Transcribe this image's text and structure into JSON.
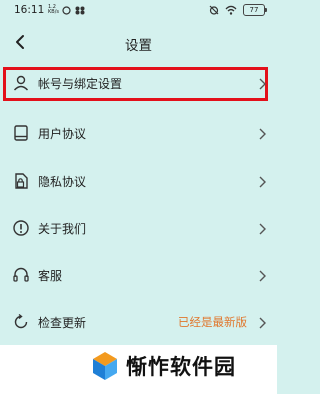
{
  "status_bar": {
    "time": "16:11",
    "signal_text": "1.2 KB/s",
    "battery": "77"
  },
  "header": {
    "title": "设置"
  },
  "menu": {
    "items": [
      {
        "label": "帐号与绑定设置",
        "icon": "person-icon"
      },
      {
        "label": "用户协议",
        "icon": "book-icon"
      },
      {
        "label": "隐私协议",
        "icon": "lock-document-icon"
      },
      {
        "label": "关于我们",
        "icon": "info-icon"
      },
      {
        "label": "客服",
        "icon": "headset-icon"
      },
      {
        "label": "检查更新",
        "icon": "refresh-icon",
        "value": "已经是最新版"
      }
    ]
  },
  "watermark": {
    "text": "惭怍软件园"
  },
  "colors": {
    "background": "#d4f1ee",
    "highlight": "#e3101a",
    "update_status": "#e0772d"
  }
}
